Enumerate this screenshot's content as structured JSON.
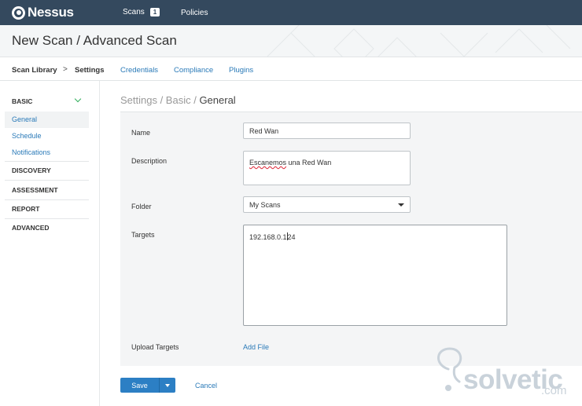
{
  "header": {
    "brand": "Nessus",
    "nav": [
      {
        "label": "Scans",
        "badge": "1"
      },
      {
        "label": "Policies"
      }
    ]
  },
  "page": {
    "title": "New Scan / Advanced Scan"
  },
  "breadcrumb": {
    "library": "Scan Library",
    "separator": ">",
    "current": "Settings",
    "tabs": [
      "Credentials",
      "Compliance",
      "Plugins"
    ]
  },
  "sidebar": {
    "basic": "BASIC",
    "basic_items": [
      "General",
      "Schedule",
      "Notifications"
    ],
    "sections": [
      "DISCOVERY",
      "ASSESSMENT",
      "REPORT",
      "ADVANCED"
    ]
  },
  "main": {
    "path_prefix": "Settings / Basic / ",
    "path_current": "General",
    "form": {
      "name_label": "Name",
      "name_value": "Red Wan",
      "description_label": "Description",
      "description_word1": "Escanemos",
      "description_rest": " una Red Wan",
      "folder_label": "Folder",
      "folder_value": "My Scans",
      "targets_label": "Targets",
      "targets_before_cursor": "192.168.0.1",
      "targets_after_cursor": "24",
      "upload_label": "Upload Targets",
      "add_file": "Add File"
    }
  },
  "actions": {
    "save": "Save",
    "cancel": "Cancel"
  },
  "watermark": {
    "text": "solvetic",
    "suffix": ".com"
  },
  "colors": {
    "topbar": "#34495e",
    "link": "#2a7ab8",
    "primary_button": "#2c7fc4",
    "panel_bg": "#f4f5f6",
    "check_green": "#2fae5a"
  }
}
